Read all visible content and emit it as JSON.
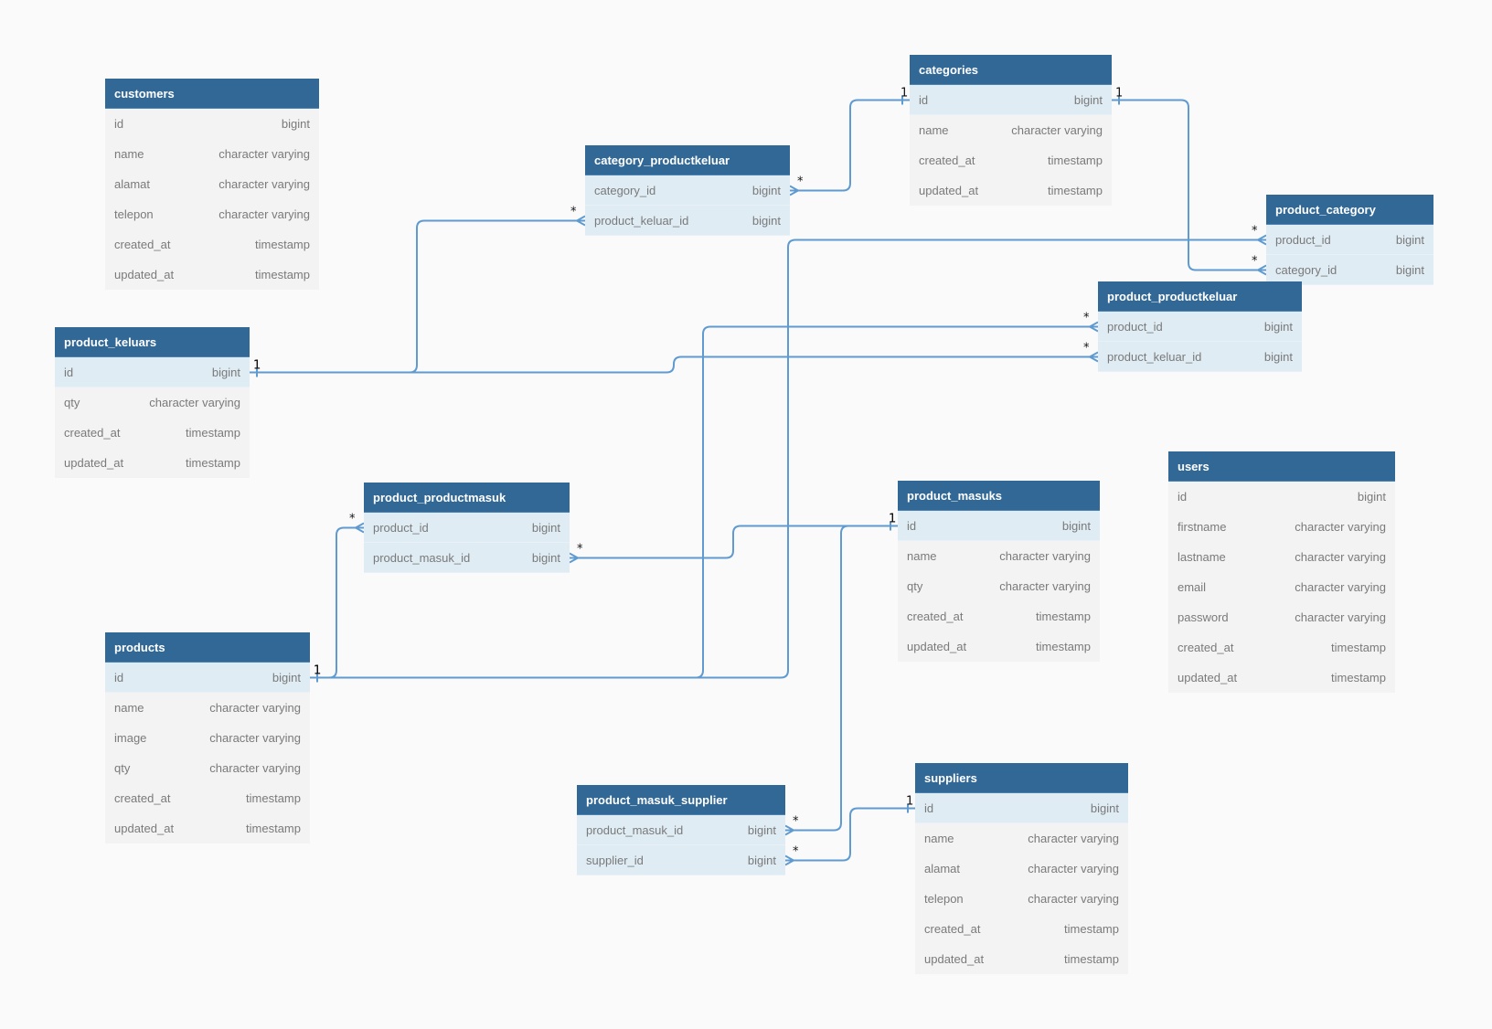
{
  "colors": {
    "header": "#326896",
    "row": "#f3f3f3",
    "highlight": "#dfecf4",
    "line": "#5f9bd0",
    "background": "#fafafa"
  },
  "tables": [
    {
      "name": "customers",
      "fields": [
        {
          "name": "id",
          "type": "bigint"
        },
        {
          "name": "name",
          "type": "character varying"
        },
        {
          "name": "alamat",
          "type": "character varying"
        },
        {
          "name": "telepon",
          "type": "character varying"
        },
        {
          "name": "created_at",
          "type": "timestamp"
        },
        {
          "name": "updated_at",
          "type": "timestamp"
        }
      ]
    },
    {
      "name": "categories",
      "fields": [
        {
          "name": "id",
          "type": "bigint",
          "highlighted": true
        },
        {
          "name": "name",
          "type": "character varying"
        },
        {
          "name": "created_at",
          "type": "timestamp"
        },
        {
          "name": "updated_at",
          "type": "timestamp"
        }
      ]
    },
    {
      "name": "category_productkeluar",
      "fields": [
        {
          "name": "category_id",
          "type": "bigint",
          "highlighted": true
        },
        {
          "name": "product_keluar_id",
          "type": "bigint",
          "highlighted": true
        }
      ]
    },
    {
      "name": "product_category",
      "fields": [
        {
          "name": "product_id",
          "type": "bigint",
          "highlighted": true
        },
        {
          "name": "category_id",
          "type": "bigint",
          "highlighted": true
        }
      ]
    },
    {
      "name": "product_productkeluar",
      "fields": [
        {
          "name": "product_id",
          "type": "bigint",
          "highlighted": true
        },
        {
          "name": "product_keluar_id",
          "type": "bigint",
          "highlighted": true
        }
      ]
    },
    {
      "name": "product_keluars",
      "fields": [
        {
          "name": "id",
          "type": "bigint",
          "highlighted": true
        },
        {
          "name": "qty",
          "type": "character varying"
        },
        {
          "name": "created_at",
          "type": "timestamp"
        },
        {
          "name": "updated_at",
          "type": "timestamp"
        }
      ]
    },
    {
      "name": "product_productmasuk",
      "fields": [
        {
          "name": "product_id",
          "type": "bigint",
          "highlighted": true
        },
        {
          "name": "product_masuk_id",
          "type": "bigint",
          "highlighted": true
        }
      ]
    },
    {
      "name": "product_masuks",
      "fields": [
        {
          "name": "id",
          "type": "bigint",
          "highlighted": true
        },
        {
          "name": "name",
          "type": "character varying"
        },
        {
          "name": "qty",
          "type": "character varying"
        },
        {
          "name": "created_at",
          "type": "timestamp"
        },
        {
          "name": "updated_at",
          "type": "timestamp"
        }
      ]
    },
    {
      "name": "users",
      "fields": [
        {
          "name": "id",
          "type": "bigint"
        },
        {
          "name": "firstname",
          "type": "character varying"
        },
        {
          "name": "lastname",
          "type": "character varying"
        },
        {
          "name": "email",
          "type": "character varying"
        },
        {
          "name": "password",
          "type": "character varying"
        },
        {
          "name": "created_at",
          "type": "timestamp"
        },
        {
          "name": "updated_at",
          "type": "timestamp"
        }
      ]
    },
    {
      "name": "products",
      "fields": [
        {
          "name": "id",
          "type": "bigint",
          "highlighted": true
        },
        {
          "name": "name",
          "type": "character varying"
        },
        {
          "name": "image",
          "type": "character varying"
        },
        {
          "name": "qty",
          "type": "character varying"
        },
        {
          "name": "created_at",
          "type": "timestamp"
        },
        {
          "name": "updated_at",
          "type": "timestamp"
        }
      ]
    },
    {
      "name": "product_masuk_supplier",
      "fields": [
        {
          "name": "product_masuk_id",
          "type": "bigint",
          "highlighted": true
        },
        {
          "name": "supplier_id",
          "type": "bigint",
          "highlighted": true
        }
      ]
    },
    {
      "name": "suppliers",
      "fields": [
        {
          "name": "id",
          "type": "bigint",
          "highlighted": true
        },
        {
          "name": "name",
          "type": "character varying"
        },
        {
          "name": "alamat",
          "type": "character varying"
        },
        {
          "name": "telepon",
          "type": "character varying"
        },
        {
          "name": "created_at",
          "type": "timestamp"
        },
        {
          "name": "updated_at",
          "type": "timestamp"
        }
      ]
    }
  ],
  "relationships": [
    {
      "one": "categories.id",
      "many": "category_productkeluar.category_id",
      "one_label": "1",
      "many_label": "*"
    },
    {
      "one": "categories.id",
      "many": "product_category.category_id",
      "one_label": "1",
      "many_label": "*"
    },
    {
      "one": "product_keluars.id",
      "many": "category_productkeluar.product_keluar_id",
      "one_label": "1",
      "many_label": "*"
    },
    {
      "one": "product_keluars.id",
      "many": "product_productkeluar.product_keluar_id",
      "one_label": "1",
      "many_label": "*"
    },
    {
      "one": "products.id",
      "many": "product_productmasuk.product_id",
      "one_label": "1",
      "many_label": "*"
    },
    {
      "one": "products.id",
      "many": "product_productkeluar.product_id",
      "one_label": "1",
      "many_label": "*"
    },
    {
      "one": "products.id",
      "many": "product_category.product_id",
      "one_label": "1",
      "many_label": "*"
    },
    {
      "one": "product_masuks.id",
      "many": "product_productmasuk.product_masuk_id",
      "one_label": "1",
      "many_label": "*"
    },
    {
      "one": "product_masuks.id",
      "many": "product_masuk_supplier.product_masuk_id",
      "one_label": "1",
      "many_label": "*"
    },
    {
      "one": "suppliers.id",
      "many": "product_masuk_supplier.supplier_id",
      "one_label": "1",
      "many_label": "*"
    }
  ]
}
